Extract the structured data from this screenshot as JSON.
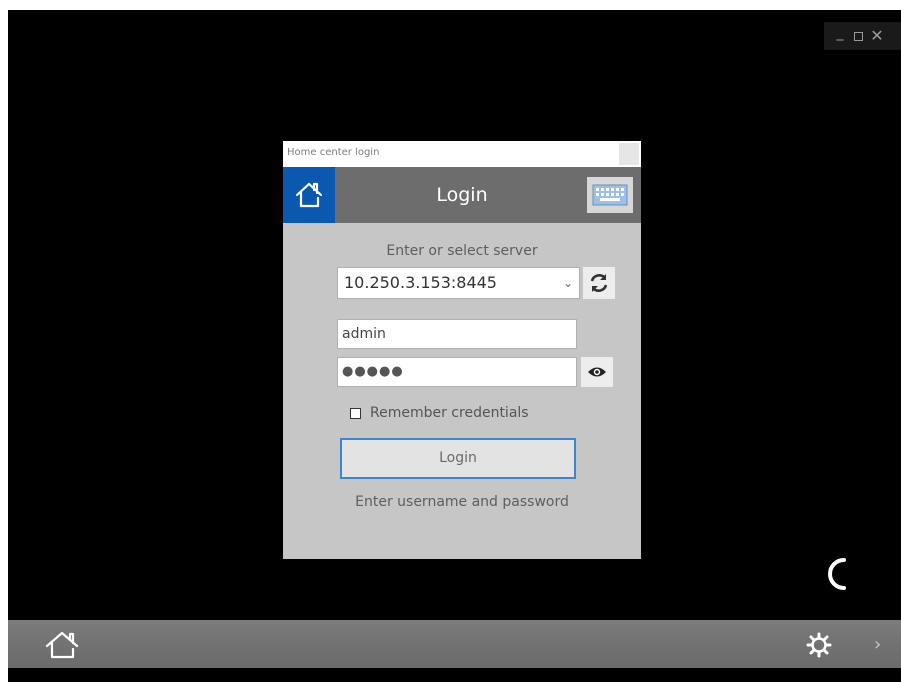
{
  "window": {
    "controls": [
      "minimize-icon",
      "maximize-icon",
      "close-icon"
    ]
  },
  "dialog": {
    "titlebar_text": "Home center login",
    "header_title": "Login",
    "server_label": "Enter or select server",
    "server_value": "10.250.3.153:8445",
    "username_value": "admin",
    "password_masked": "●●●●●",
    "remember_label": "Remember credentials",
    "remember_checked": false,
    "login_button": "Login",
    "status_message": "Enter username and password"
  },
  "bottombar": {
    "icons": [
      "home-icon",
      "gear-icon",
      "chevron-right-icon"
    ]
  },
  "colors": {
    "background": "#000000",
    "dialog_bg": "#c6c6c6",
    "header_bg": "#6d6d6d",
    "accent_blue": "#0a58b0",
    "login_border": "#3d86cf"
  }
}
